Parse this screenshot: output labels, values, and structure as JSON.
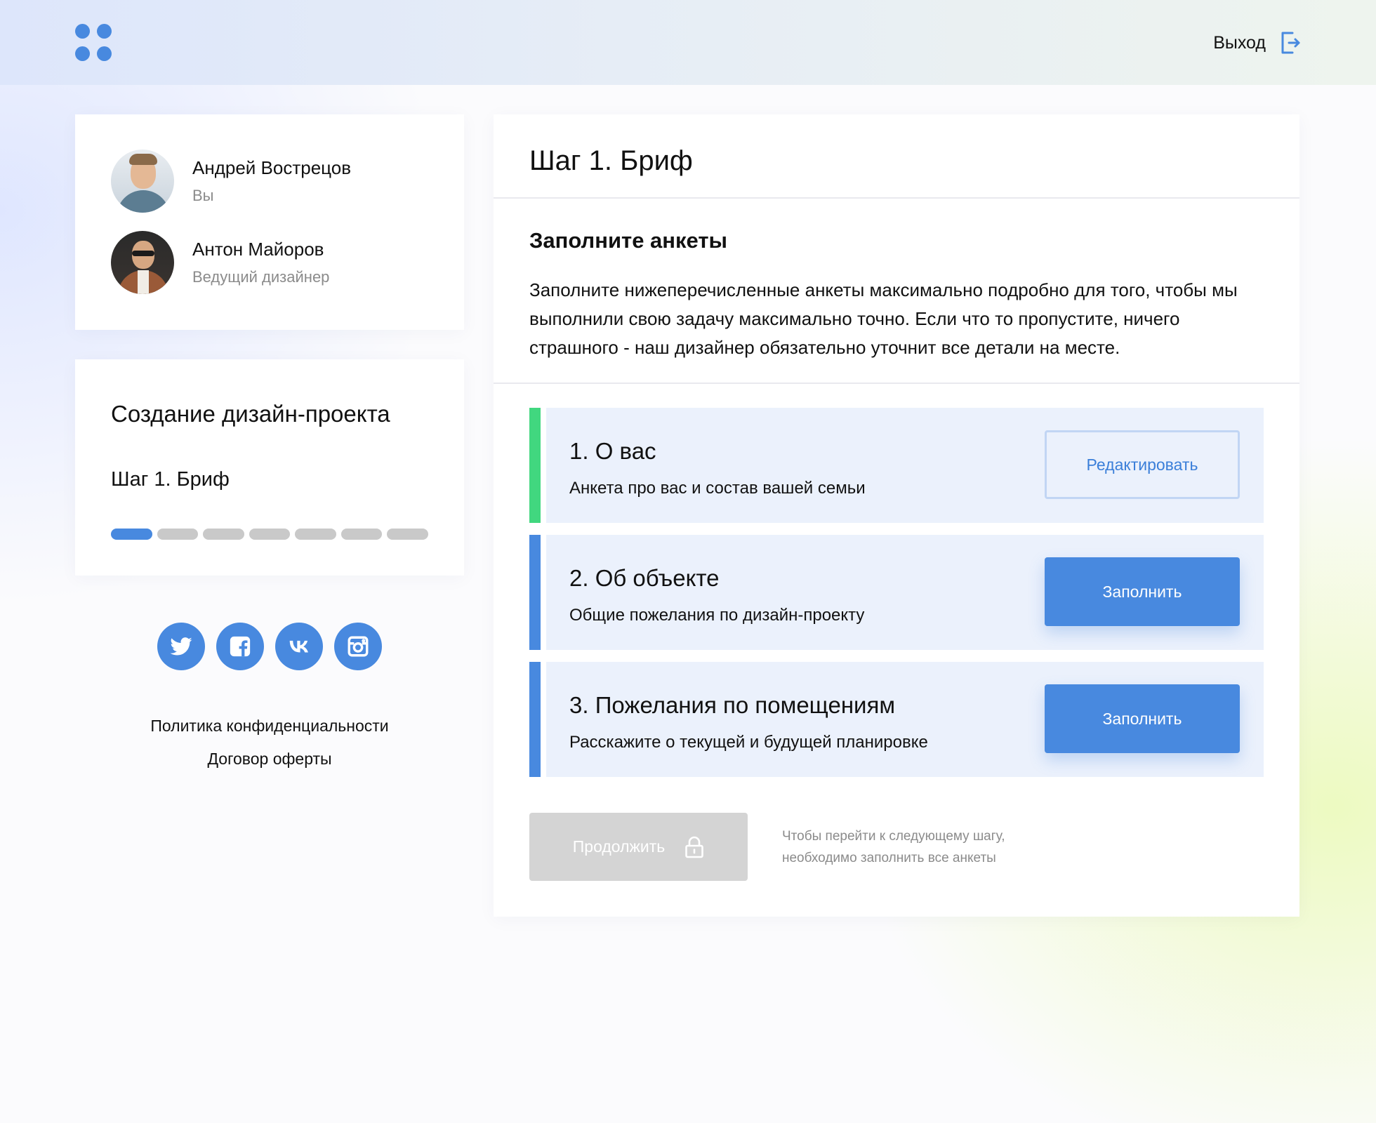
{
  "header": {
    "logout_label": "Выход",
    "icons": {
      "logo": "four-dots-logo",
      "logout": "logout-icon"
    }
  },
  "team": [
    {
      "name": "Андрей Вострецов",
      "role": "Вы"
    },
    {
      "name": "Антон Майоров",
      "role": "Ведущий дизайнер"
    }
  ],
  "project": {
    "title": "Создание дизайн-проекта",
    "current_step": "Шаг 1. Бриф",
    "progress": {
      "completed_steps": 1,
      "total_steps": 7
    }
  },
  "socials": [
    {
      "icon": "twitter-icon"
    },
    {
      "icon": "facebook-icon"
    },
    {
      "icon": "vk-icon"
    },
    {
      "icon": "instagram-icon"
    }
  ],
  "footer": {
    "privacy_link": "Политика конфиденциальности",
    "offer_link": "Договор оферты"
  },
  "main": {
    "title": "Шаг 1. Бриф",
    "section_title": "Заполните анкеты",
    "section_description": "Заполните нижеперечисленные анкеты максимально подробно для того, чтобы мы выполнили свою задачу максимально точно. Если что то пропустите, ничего страшного - наш дизайнер обязательно уточнит все детали на месте.",
    "questionnaires": [
      {
        "title": "1. О вас",
        "description": "Анкета про вас и состав вашей семьи",
        "button_label": "Редактировать",
        "status": "completed"
      },
      {
        "title": "2. Об объекте",
        "description": "Общие пожелания по дизайн-проекту",
        "button_label": "Заполнить",
        "status": "pending"
      },
      {
        "title": "3. Пожелания по помещениям",
        "description": "Расскажите о текущей и будущей планировке",
        "button_label": "Заполнить",
        "status": "pending"
      }
    ],
    "continue_label": "Продолжить",
    "continue_hint": "Чтобы перейти к следующему шагу, необходимо заполнить все анкеты"
  },
  "colors": {
    "accent": "#4889df",
    "done": "#41d77f",
    "disabled": "#d4d4d4",
    "questionnaire_bg": "#ebf1fc"
  }
}
